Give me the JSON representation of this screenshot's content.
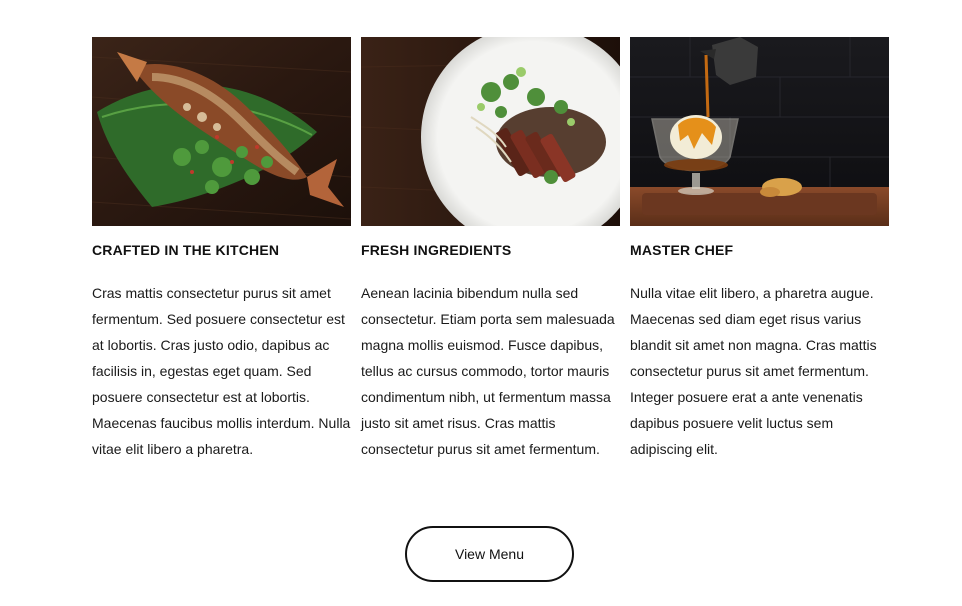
{
  "features": [
    {
      "image": "fish-dish-photo",
      "title": "CRAFTED IN THE KITCHEN",
      "text": "Cras mattis consectetur purus sit amet fermentum. Sed posuere consectetur est at lobortis. Cras justo odio, dapibus ac facilisis in, egestas eget quam. Sed posuere consectetur est at lobortis. Maecenas faucibus mollis interdum. Nulla vitae elit libero a pharetra."
    },
    {
      "image": "steak-plate-photo",
      "title": "FRESH INGREDIENTS",
      "text": "Aenean lacinia bibendum nulla sed consectetur. Etiam porta sem malesuada magna mollis euismod. Fusce dapibus, tellus ac cursus commodo, tortor mauris condimentum nibh, ut fermentum massa justo sit amet risus. Cras mattis consectetur purus sit amet fermentum."
    },
    {
      "image": "dessert-pour-photo",
      "title": "MASTER CHEF",
      "text": "Nulla vitae elit libero, a pharetra augue. Maecenas sed diam eget risus varius blandit sit amet non magna. Cras mattis consectetur purus sit amet fermentum. Integer posuere erat a ante venenatis dapibus posuere velit luctus sem adipiscing elit."
    }
  ],
  "cta": {
    "label": "View Menu"
  },
  "colors": {
    "text": "#111111",
    "background": "#ffffff",
    "button_border": "#111111"
  }
}
